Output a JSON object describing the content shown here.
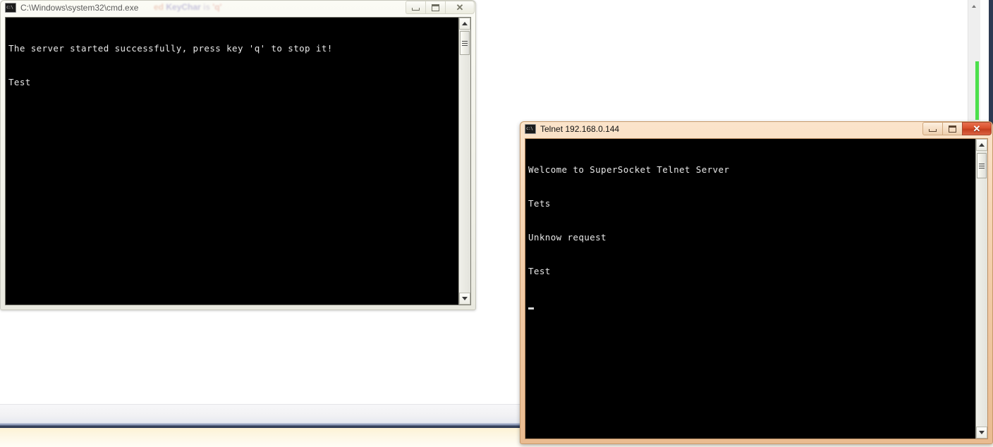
{
  "desktop": {
    "background_color": "#ffffff",
    "bottom_bar_color": "#f2f2f4",
    "accent_blue": "#2e3a52",
    "accent_cream": "#fdf2d4",
    "ghost_text": "- + ^"
  },
  "background_app": {
    "scrollbar": {
      "name": "vertical-scrollbar",
      "thumb_color": "#4ce04c",
      "up_arrow": "▲"
    }
  },
  "windows": [
    {
      "id": "cmd",
      "state": "inactive",
      "title": "C:\\Windows\\system32\\cmd.exe",
      "icon": "console-icon",
      "ghost_title_fragments": [
        "ed",
        "KeyChar",
        "is",
        "'q'"
      ],
      "controls": {
        "minimize": "Minimize",
        "maximize": "Maximize",
        "close": "Close"
      },
      "console": {
        "background": "#000000",
        "foreground": "#e8e8e8",
        "lines": [
          "The server started successfully, press key 'q' to stop it!",
          "Test"
        ]
      },
      "scrollbar": {
        "up_label": "Scroll up",
        "down_label": "Scroll down"
      }
    },
    {
      "id": "telnet",
      "state": "active",
      "title": "Telnet 192.168.0.144",
      "icon": "console-icon",
      "controls": {
        "minimize": "Minimize",
        "maximize": "Maximize",
        "close": "Close"
      },
      "console": {
        "background": "#000000",
        "foreground": "#e8e8e8",
        "lines": [
          "Welcome to SuperSocket Telnet Server",
          "Tets",
          "Unknow request",
          "Test"
        ],
        "cursor": "block"
      },
      "scrollbar": {
        "up_label": "Scroll up",
        "down_label": "Scroll down"
      }
    }
  ],
  "glyphs": {
    "minimize": "—",
    "maximize": "▣",
    "close": "✕",
    "arrow_up": "▲",
    "arrow_down": "▼"
  }
}
